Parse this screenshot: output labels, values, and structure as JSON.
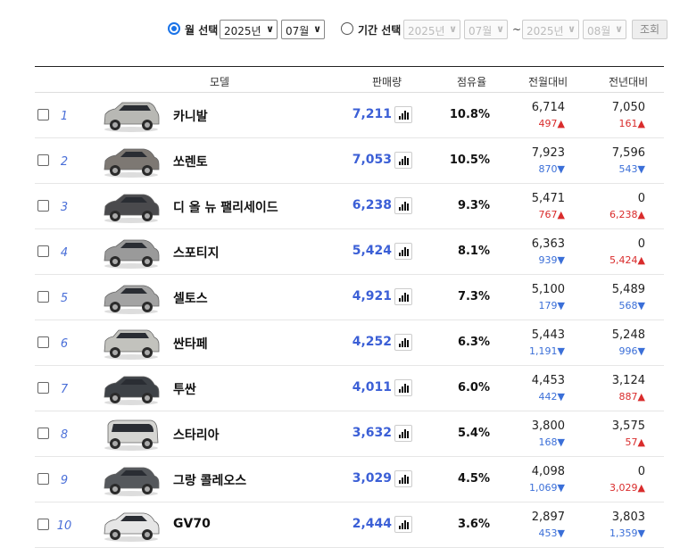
{
  "filter": {
    "month_label": "월 선택",
    "month_year": "2025년",
    "month_month": "07월",
    "period_label": "기간 선택",
    "from_year": "2025년",
    "from_month": "07월",
    "range_sep": "~",
    "to_year": "2025년",
    "to_month": "08월",
    "search_button": "조회"
  },
  "table": {
    "headers": {
      "model": "모델",
      "sales": "판매량",
      "share": "점유율",
      "mom": "전월대비",
      "yoy": "전년대비"
    },
    "rows": [
      {
        "rank": "1",
        "model": "카니발",
        "sales": "7,211",
        "share": "10.8%",
        "mom_value": "6,714",
        "mom_diff": "497▲",
        "yoy_value": "7,050",
        "yoy_diff": "161▲",
        "body": "mpv",
        "color": "#b8b8b4"
      },
      {
        "rank": "2",
        "model": "쏘렌토",
        "sales": "7,053",
        "share": "10.5%",
        "mom_value": "7,923",
        "mom_diff": "870▼",
        "yoy_value": "7,596",
        "yoy_diff": "543▼",
        "body": "suv",
        "color": "#7d7873"
      },
      {
        "rank": "3",
        "model": "디 올 뉴 팰리세이드",
        "sales": "6,238",
        "share": "9.3%",
        "mom_value": "5,471",
        "mom_diff": "767▲",
        "yoy_value": "0",
        "yoy_diff": "6,238▲",
        "body": "suv",
        "color": "#4a4a4d"
      },
      {
        "rank": "4",
        "model": "스포티지",
        "sales": "5,424",
        "share": "8.1%",
        "mom_value": "6,363",
        "mom_diff": "939▼",
        "yoy_value": "0",
        "yoy_diff": "5,424▲",
        "body": "suv",
        "color": "#9a9a9a"
      },
      {
        "rank": "5",
        "model": "셀토스",
        "sales": "4,921",
        "share": "7.3%",
        "mom_value": "5,100",
        "mom_diff": "179▼",
        "yoy_value": "5,489",
        "yoy_diff": "568▼",
        "body": "suv",
        "color": "#a3a3a3"
      },
      {
        "rank": "6",
        "model": "싼타페",
        "sales": "4,252",
        "share": "6.3%",
        "mom_value": "5,443",
        "mom_diff": "1,191▼",
        "yoy_value": "5,248",
        "yoy_diff": "996▼",
        "body": "box",
        "color": "#c2c2bd"
      },
      {
        "rank": "7",
        "model": "투싼",
        "sales": "4,011",
        "share": "6.0%",
        "mom_value": "4,453",
        "mom_diff": "442▼",
        "yoy_value": "3,124",
        "yoy_diff": "887▲",
        "body": "suv",
        "color": "#3e4247"
      },
      {
        "rank": "8",
        "model": "스타리아",
        "sales": "3,632",
        "share": "5.4%",
        "mom_value": "3,800",
        "mom_diff": "168▼",
        "yoy_value": "3,575",
        "yoy_diff": "57▲",
        "body": "van",
        "color": "#d5d5d2"
      },
      {
        "rank": "9",
        "model": "그랑 콜레오스",
        "sales": "3,029",
        "share": "4.5%",
        "mom_value": "4,098",
        "mom_diff": "1,069▼",
        "yoy_value": "0",
        "yoy_diff": "3,029▲",
        "body": "suv",
        "color": "#55585c"
      },
      {
        "rank": "10",
        "model": "GV70",
        "sales": "2,444",
        "share": "3.6%",
        "mom_value": "2,897",
        "mom_diff": "453▼",
        "yoy_value": "3,803",
        "yoy_diff": "1,359▼",
        "body": "suv",
        "color": "#e6e6e6"
      }
    ]
  },
  "colors": {
    "accent": "#1a73e8",
    "sales_text": "#3b5fd6",
    "increase": "#d92c2c",
    "decrease": "#3b6fd8"
  }
}
